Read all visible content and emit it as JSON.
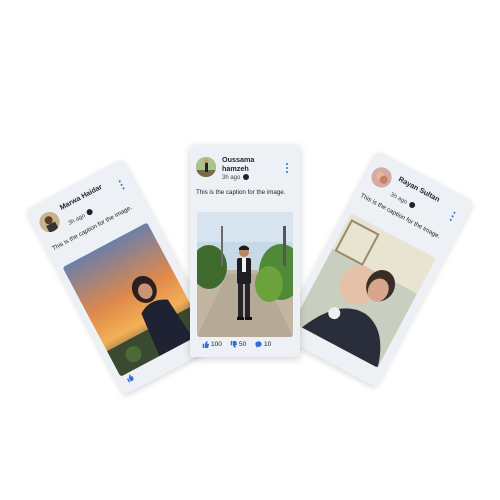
{
  "posts": {
    "left": {
      "author": "Marwa Haidar",
      "time": "3h ago",
      "caption": "This is the caption for the image."
    },
    "center": {
      "author": "Oussama hamzeh",
      "time": "3h ago",
      "caption": "This is the caption for the image.",
      "likes": "100",
      "dislikes": "50",
      "comments": "10"
    },
    "right": {
      "author": "Rayan Sultan",
      "time": "3h ago",
      "caption": "This is the caption for the image."
    }
  },
  "icons": {
    "visibility": "globe-icon",
    "menu": "more-vertical-icon",
    "like": "thumbs-up-icon",
    "dislike": "thumbs-down-icon",
    "comment": "comment-icon"
  },
  "colors": {
    "accent": "#2f6fd6",
    "card_bg": "#edf0f4",
    "page_bg": "#ffffff"
  }
}
